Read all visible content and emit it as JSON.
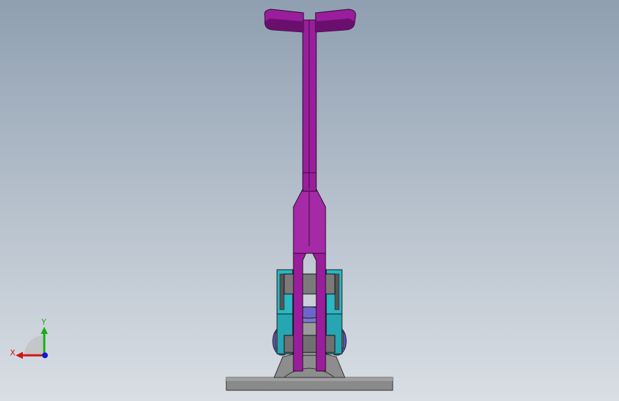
{
  "viewport": {
    "background_top": "#8f9fb1",
    "background_bottom": "#d9dee4"
  },
  "model": {
    "handle_color": "#9a1e9c",
    "handle_dark": "#6a0f6e",
    "link_color": "#2bb7c4",
    "base_color": "#8a8a8a",
    "pin_color": "#7a6fc8"
  },
  "triad": {
    "x_label": "X",
    "y_label": "Y",
    "x_color": "#d01515",
    "y_color": "#15b015",
    "z_color": "#1515d0"
  }
}
